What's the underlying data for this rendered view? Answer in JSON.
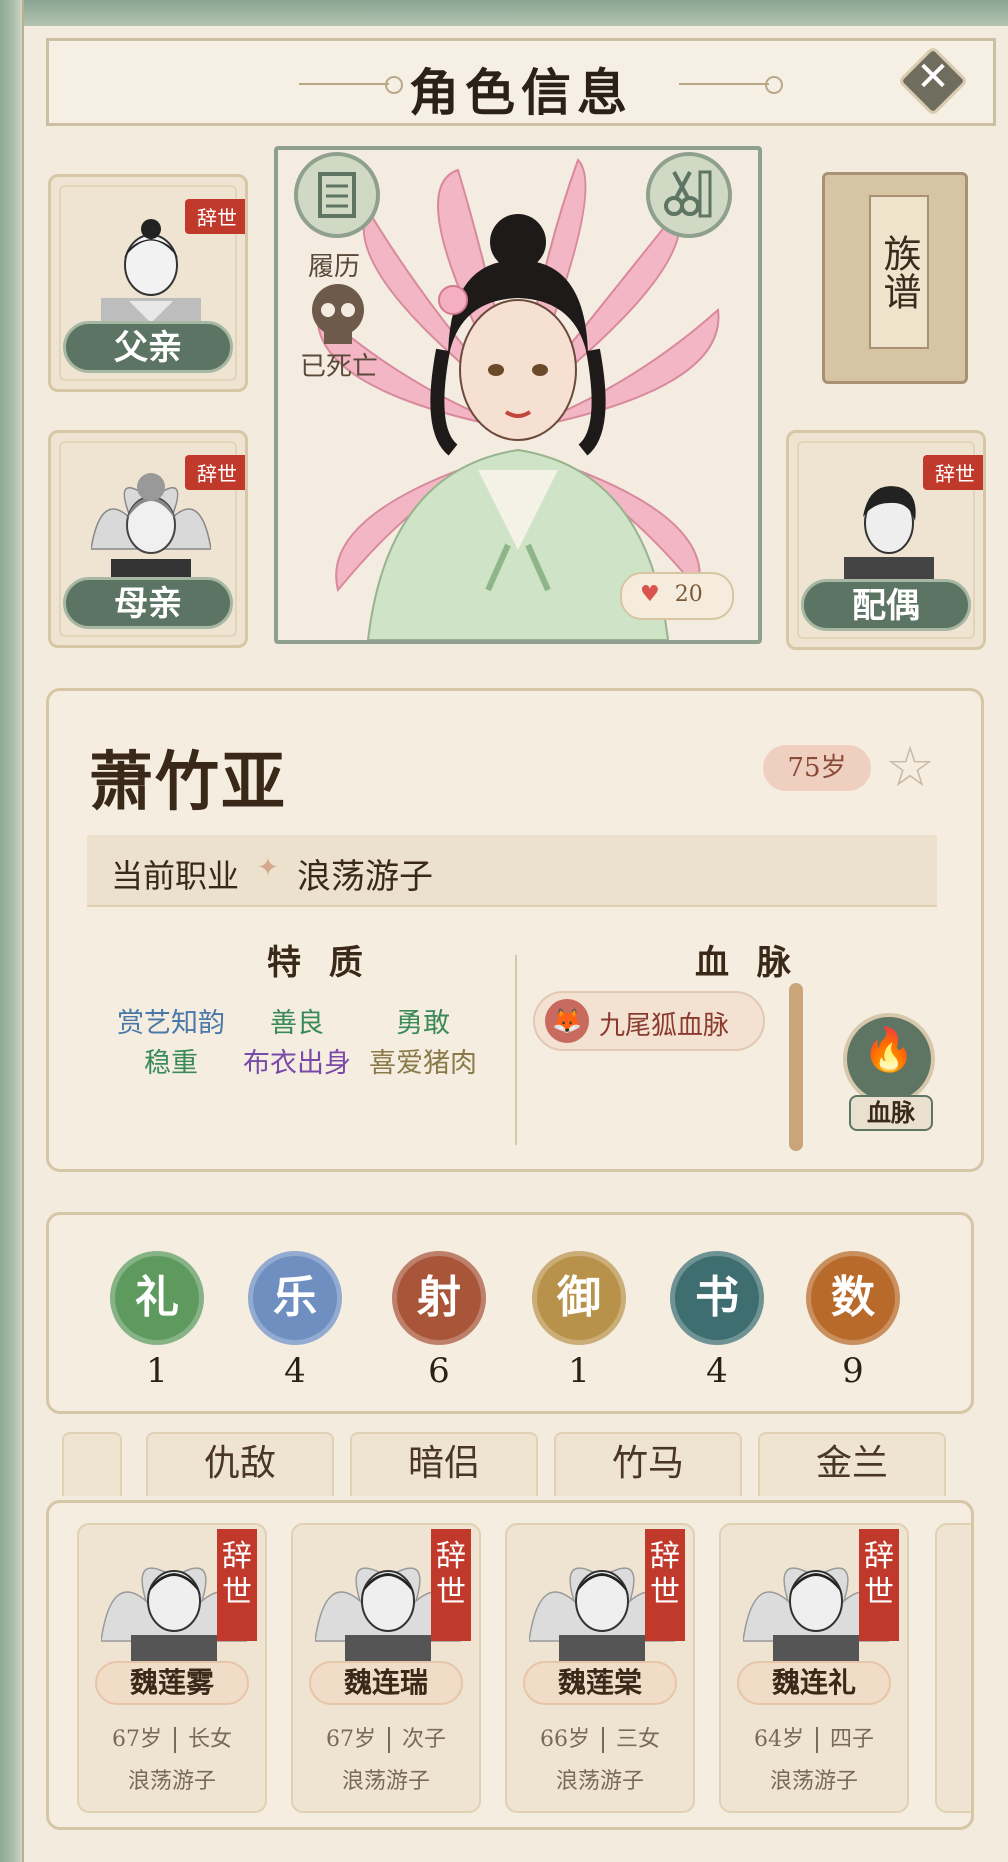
{
  "header": {
    "title": "角色信息"
  },
  "parents": {
    "father": {
      "label": "父亲",
      "status": "辞世"
    },
    "mother": {
      "label": "母亲",
      "status": "辞世"
    },
    "spouse": {
      "label": "配偶",
      "status": "辞世"
    }
  },
  "portrait": {
    "resume_label": "履历",
    "dead_label": "已死亡",
    "hearts": "20"
  },
  "genealogy": {
    "label": "族谱"
  },
  "character": {
    "name": "萧竹亚",
    "age": "75岁",
    "job_label": "当前职业",
    "job_value": "浪荡游子"
  },
  "traits": {
    "title": "特 质",
    "items": [
      "赏艺知韵",
      "善良",
      "勇敢",
      "稳重",
      "布衣出身",
      "喜爱猪肉"
    ],
    "colors": [
      "#4a78a8",
      "#3a8a5a",
      "#3a8a5a",
      "#3a8a5a",
      "#7a4aa8",
      "#8a7a4a"
    ]
  },
  "bloodline": {
    "title": "血 脉",
    "chip": "九尾狐血脉",
    "button_label": "血脉"
  },
  "skills": [
    {
      "name": "礼",
      "value": "1",
      "color": "#5e9a5e"
    },
    {
      "name": "乐",
      "value": "4",
      "color": "#6f8fc0"
    },
    {
      "name": "射",
      "value": "6",
      "color": "#a8553a"
    },
    {
      "name": "御",
      "value": "1",
      "color": "#b8924a"
    },
    {
      "name": "书",
      "value": "4",
      "color": "#3f6e70"
    },
    {
      "name": "数",
      "value": "9",
      "color": "#b86a2a"
    }
  ],
  "tabs": [
    "仇敌",
    "暗侣",
    "竹马",
    "金兰"
  ],
  "children": [
    {
      "name": "魏莲雾",
      "age": "67岁",
      "rank": "长女",
      "job": "浪荡游子",
      "status": "辞世"
    },
    {
      "name": "魏连瑞",
      "age": "67岁",
      "rank": "次子",
      "job": "浪荡游子",
      "status": "辞世"
    },
    {
      "name": "魏莲棠",
      "age": "66岁",
      "rank": "三女",
      "job": "浪荡游子",
      "status": "辞世"
    },
    {
      "name": "魏连礼",
      "age": "64岁",
      "rank": "四子",
      "job": "浪荡游子",
      "status": "辞世"
    }
  ]
}
